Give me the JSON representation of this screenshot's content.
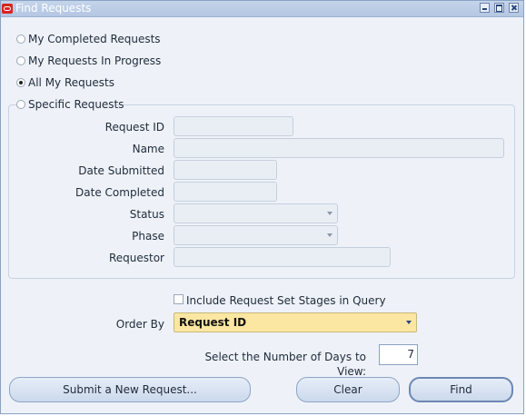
{
  "window": {
    "title": "Find Requests"
  },
  "radios": [
    {
      "label": "My Completed Requests",
      "checked": false
    },
    {
      "label": "My Requests In Progress",
      "checked": false
    },
    {
      "label": "All My Requests",
      "checked": true
    },
    {
      "label": "Specific Requests",
      "checked": false
    }
  ],
  "fields": {
    "request_id": {
      "label": "Request ID",
      "value": ""
    },
    "name": {
      "label": "Name",
      "value": ""
    },
    "date_submitted": {
      "label": "Date Submitted",
      "value": ""
    },
    "date_completed": {
      "label": "Date Completed",
      "value": ""
    },
    "status": {
      "label": "Status",
      "value": ""
    },
    "phase": {
      "label": "Phase",
      "value": ""
    },
    "requestor": {
      "label": "Requestor",
      "value": ""
    }
  },
  "include_stages": {
    "label": "Include Request Set Stages in Query",
    "checked": false
  },
  "order_by": {
    "label": "Order By",
    "value": "Request ID"
  },
  "days": {
    "label": "Select the Number of Days to View:",
    "value": "7"
  },
  "buttons": {
    "submit": "Submit a New Request...",
    "clear": "Clear",
    "find": "Find"
  }
}
